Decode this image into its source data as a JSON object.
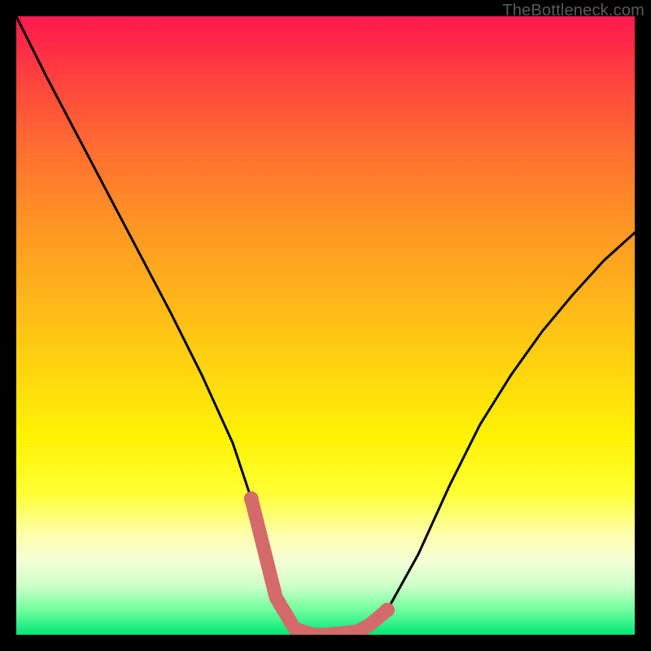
{
  "watermark": "TheBottleneck.com",
  "chart_data": {
    "type": "line",
    "title": "",
    "xlabel": "",
    "ylabel": "",
    "xlim": [
      0,
      100
    ],
    "ylim": [
      0,
      100
    ],
    "series": [
      {
        "name": "bottleneck-curve",
        "x": [
          0,
          5,
          10,
          15,
          20,
          25,
          30,
          35,
          38,
          40,
          42,
          45,
          48,
          50,
          55,
          60,
          65,
          70,
          75,
          80,
          85,
          90,
          95,
          100
        ],
        "values": [
          100,
          90,
          80.5,
          71,
          61.5,
          52,
          42,
          31,
          22,
          14,
          6,
          1,
          0,
          0,
          0.5,
          4,
          13,
          24,
          34,
          42,
          49,
          55,
          60.5,
          65
        ]
      },
      {
        "name": "highlight-valley",
        "x": [
          38,
          40,
          42,
          45,
          48,
          50,
          52,
          55,
          57,
          60
        ],
        "values": [
          22,
          14,
          6,
          1,
          0,
          0,
          0.2,
          0.5,
          1.5,
          4
        ]
      }
    ],
    "colors": {
      "curve": "#000000",
      "highlight": "#d46a6a",
      "gradient_top": "#ff1a4f",
      "gradient_bottom": "#00e676"
    }
  }
}
